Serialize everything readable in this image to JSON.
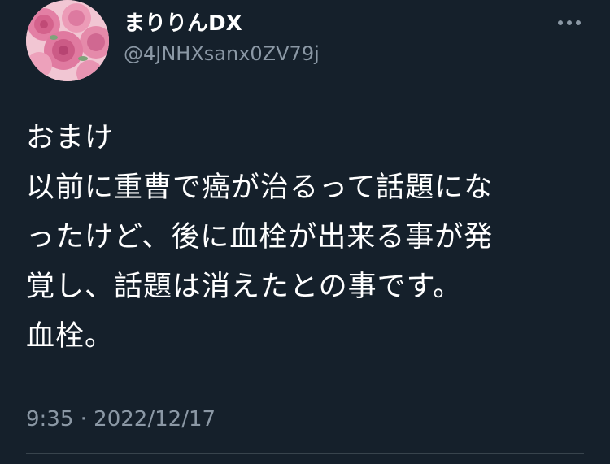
{
  "user": {
    "display_name": "まりりんDX",
    "handle": "@4JNHXsanx0ZV79j",
    "avatar_icon": "rose-bouquet-avatar"
  },
  "more_icon": "more-dots-icon",
  "tweet": {
    "lines": [
      "おまけ",
      "以前に重曹で癌が治るって話題にな",
      "ったけど、後に血栓が出来る事が発",
      "覚し、話題は消えたとの事です。",
      "血栓。"
    ]
  },
  "meta": {
    "timestamp": "9:35 · 2022/12/17"
  },
  "colors": {
    "background": "#15202b",
    "text_primary": "#ffffff",
    "text_secondary": "#8b98a5",
    "divider": "#38444d"
  }
}
